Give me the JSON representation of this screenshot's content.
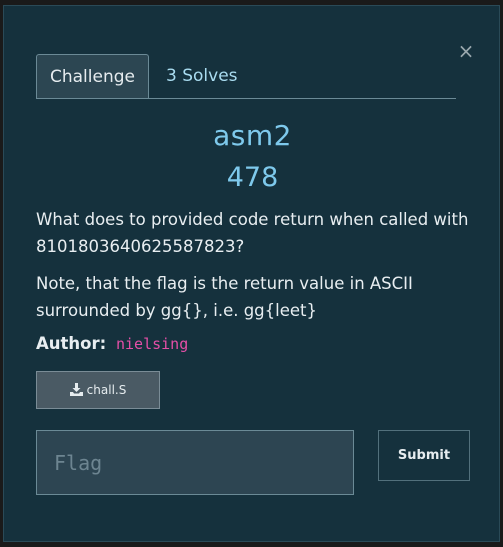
{
  "modal": {
    "close_glyph": "×",
    "tabs": [
      {
        "label": "Challenge"
      },
      {
        "label": "3 Solves"
      }
    ],
    "challenge": {
      "name": "asm2",
      "points": "478",
      "description": [
        "What does to provided code return when called with 8101803640625587823?",
        "Note, that the flag is the return value in ASCII surrounded by gg{}, i.e. gg{leet}"
      ],
      "author_label": "Author:",
      "author_name": "nielsing",
      "file": {
        "label": "chall.S",
        "icon": "download-icon"
      }
    },
    "flag_input": {
      "placeholder": "Flag",
      "value": ""
    },
    "submit_label": "Submit"
  },
  "colors": {
    "modal_bg": "#15313d",
    "accent": "#7ec9ec",
    "author_name": "#e44fa7",
    "tab_active_bg": "#2c4652"
  }
}
